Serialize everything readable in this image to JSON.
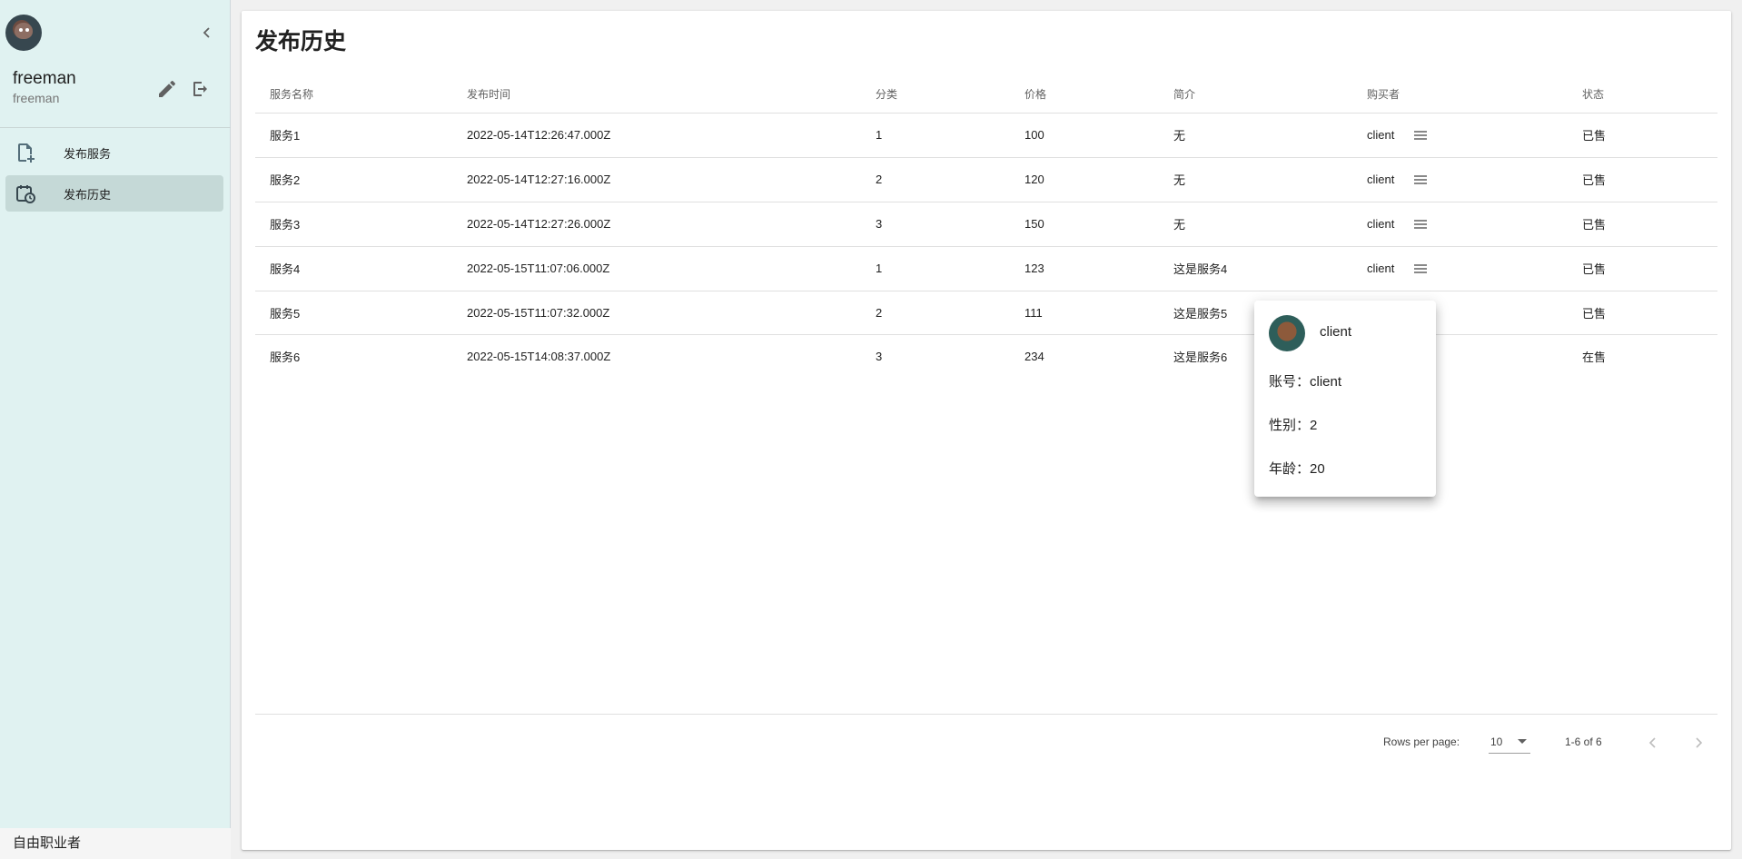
{
  "sidebar": {
    "user_name": "freeman",
    "user_sub": "freeman",
    "nav": [
      {
        "label": "发布服务",
        "icon": "file-add-icon"
      },
      {
        "label": "发布历史",
        "icon": "calendar-clock-icon"
      }
    ],
    "footer": "自由职业者"
  },
  "main": {
    "title": "发布历史",
    "columns": [
      "服务名称",
      "发布时间",
      "分类",
      "价格",
      "简介",
      "购买者",
      "状态"
    ],
    "rows": [
      {
        "name": "服务1",
        "time": "2022-05-14T12:26:47.000Z",
        "category": "1",
        "price": "100",
        "intro": "无",
        "buyer": "client",
        "status": "已售"
      },
      {
        "name": "服务2",
        "time": "2022-05-14T12:27:16.000Z",
        "category": "2",
        "price": "120",
        "intro": "无",
        "buyer": "client",
        "status": "已售"
      },
      {
        "name": "服务3",
        "time": "2022-05-14T12:27:26.000Z",
        "category": "3",
        "price": "150",
        "intro": "无",
        "buyer": "client",
        "status": "已售"
      },
      {
        "name": "服务4",
        "time": "2022-05-15T11:07:06.000Z",
        "category": "1",
        "price": "123",
        "intro": "这是服务4",
        "buyer": "client",
        "status": "已售"
      },
      {
        "name": "服务5",
        "time": "2022-05-15T11:07:32.000Z",
        "category": "2",
        "price": "111",
        "intro": "这是服务5",
        "buyer": "",
        "status": "已售"
      },
      {
        "name": "服务6",
        "time": "2022-05-15T14:08:37.000Z",
        "category": "3",
        "price": "234",
        "intro": "这是服务6",
        "buyer": "",
        "status": "在售"
      }
    ],
    "pagination": {
      "rows_per_page_label": "Rows per page:",
      "rows_per_page": "10",
      "range": "1-6 of 6"
    }
  },
  "popover": {
    "name": "client",
    "account": "账号：client",
    "gender": "性别：2",
    "age": "年龄：20"
  },
  "colors": {
    "sidebar_bg": "#e0f2f1",
    "sold": "#f44336",
    "on_sale": "#4caf50"
  }
}
